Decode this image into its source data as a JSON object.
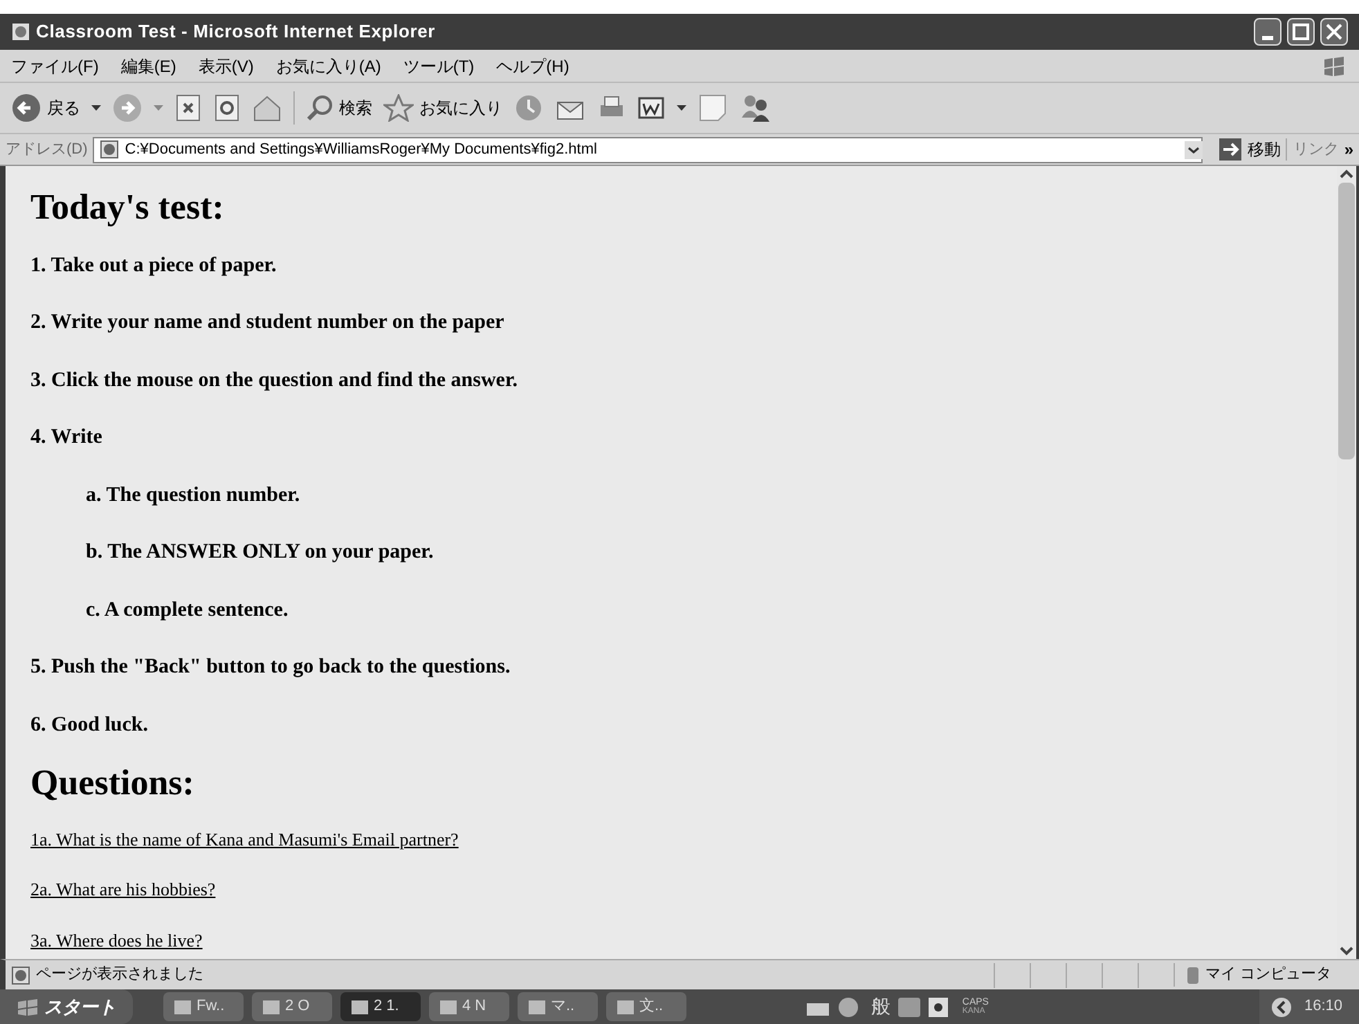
{
  "window": {
    "title": "Classroom Test - Microsoft Internet Explorer"
  },
  "menu": [
    "ファイル(F)",
    "編集(E)",
    "表示(V)",
    "お気に入り(A)",
    "ツール(T)",
    "ヘルプ(H)"
  ],
  "toolbar": {
    "back": "戻る",
    "search": "検索",
    "favorites": "お気に入り"
  },
  "address": {
    "label": "アドレス(D)",
    "value": "C:¥Documents and Settings¥WilliamsRoger¥My Documents¥fig2.html",
    "go": "移動",
    "links": "リンク",
    "more": "»"
  },
  "page": {
    "heading": "Today's test:",
    "steps": [
      {
        "text": "1. Take out a piece of paper."
      },
      {
        "text": "2. Write your name and student number on the paper"
      },
      {
        "text": "3. Click the mouse on the question and find the answer."
      },
      {
        "text": "4. Write",
        "children": [
          {
            "text": "a. The question number."
          },
          {
            "text": "b. The ANSWER ONLY on your paper."
          },
          {
            "text": "c. A complete sentence."
          }
        ]
      },
      {
        "text": "5. Push the \"Back\" button to go back to the questions."
      },
      {
        "text": "6. Good luck."
      }
    ],
    "questions_heading": "Questions:",
    "questions": [
      "1a. What is the name of Kana and Masumi's Email partner?",
      "2a. What are his hobbies?",
      "3a. Where does he live?"
    ]
  },
  "status_bar": {
    "text": "ページが表示されました",
    "zone": "マイ コンピュータ"
  },
  "taskbar": {
    "start": "スタート",
    "tasks": [
      {
        "label": "Fw..",
        "selected": false
      },
      {
        "label": "2 O",
        "selected": false
      },
      {
        "label": "2 1.",
        "selected": true
      },
      {
        "label": "4 N",
        "selected": false
      },
      {
        "label": "マ..",
        "selected": false
      },
      {
        "label": "文..",
        "selected": false
      }
    ],
    "ime": "般",
    "caps": "CAPS",
    "kana": "KANA",
    "clock": "16:10"
  }
}
